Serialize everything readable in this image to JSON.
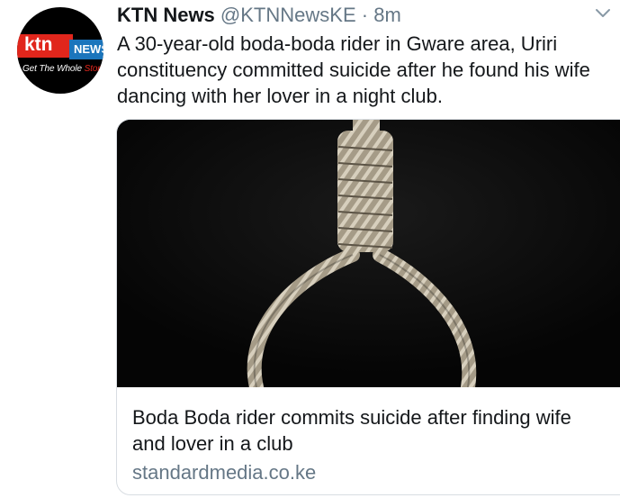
{
  "tweet": {
    "author_name": "KTN News",
    "handle": "@KTNNewsKE",
    "separator": "·",
    "time": "8m",
    "text_lines": [
      "A 30-year-old boda-boda rider in Gware area, Uriri",
      "constituency committed suicide after he found his wife",
      "dancing with her lover in a night club."
    ]
  },
  "avatar": {
    "brand_word": "ktn",
    "brand_badge": "NEWS",
    "slogan_white": "Get The Whole ",
    "slogan_red": "Story",
    "colors": {
      "background": "#000000",
      "ktn_red": "#e1261c",
      "news_blue": "#1b75bc"
    }
  },
  "card": {
    "image_icon": "noose-image",
    "title_lines": [
      "Boda Boda rider commits suicide after finding wife",
      "and lover in a club"
    ],
    "domain": "standardmedia.co.ke"
  },
  "icons": {
    "menu": "chevron-down-icon"
  },
  "colors": {
    "text": "#14171a",
    "muted": "#657786",
    "border": "#d8dde2"
  }
}
